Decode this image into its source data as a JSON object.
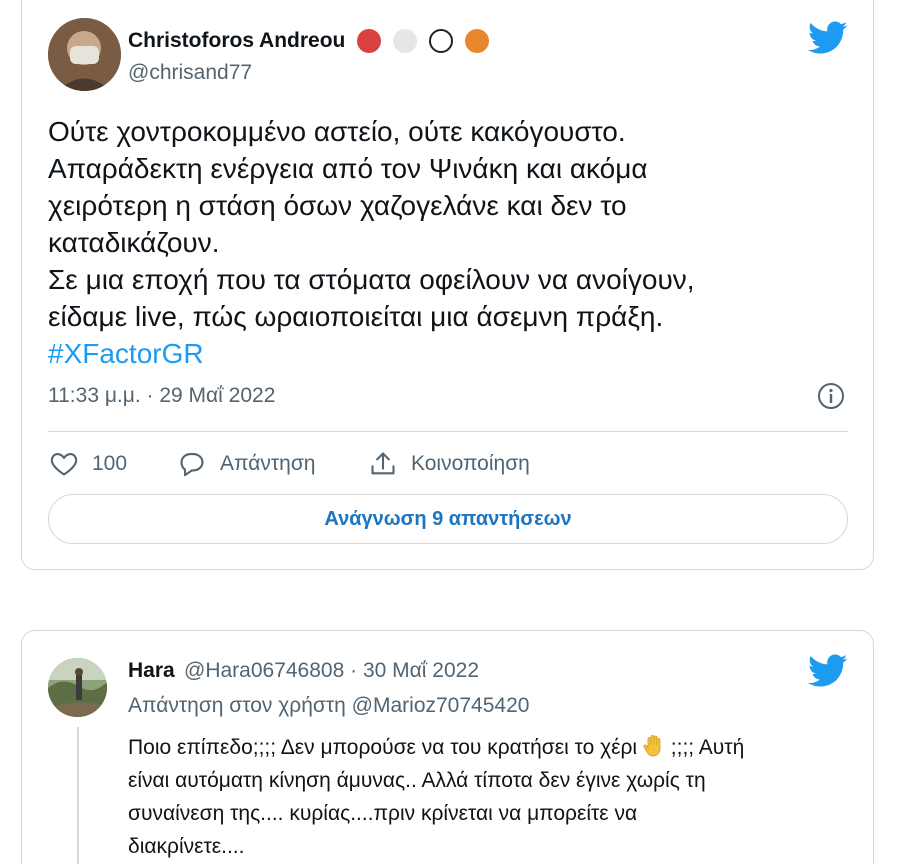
{
  "tweet": {
    "author_name": "Christoforos Andreou",
    "author_handle": "@chrisand77",
    "text_lines": [
      "Ούτε χοντροκομμένο αστείο, ούτε κακόγουστο.",
      "Απαράδεκτη ενέργεια από τον Ψινάκη και ακόμα",
      "χειρότερη η στάση όσων χαζογελάνε και δεν το",
      "καταδικάζουν.",
      "Σε μια εποχή που τα στόματα οφείλουν να ανοίγουν,",
      "είδαμε live, πώς ωραιοποιείται μια άσεμνη πράξη."
    ],
    "hashtag": "#XFactorGR",
    "timestamp": "11:33 μ.μ. · 29 Μαΐ 2022",
    "like_count": "100",
    "reply_label": "Απάντηση",
    "share_label": "Κοινοποίηση",
    "read_replies_label": "Ανάγνωση 9 απαντήσεων"
  },
  "reply": {
    "author_name": "Hara",
    "author_handle": "@Hara06746808",
    "separator": "·",
    "date": "30 Μαΐ 2022",
    "replying_to": "Απάντηση στον χρήστη @Marioz70745420",
    "text_line_1a": "Ποιο επίπεδο;;;; Δεν μπορούσε να του κρατήσει το χέρι ",
    "text_line_1b": ";;;; Αυτή",
    "text_lines": [
      "είναι αυτόματη κίνηση άμυνας..  Αλλά τίποτα δεν έγινε χωρίς τη",
      "συναίνεση της.... κυρίας....πριν κρίνεται να μπορείτε να",
      "διακρίνετε...."
    ]
  },
  "colors": {
    "twitter_blue": "#1d9bf0",
    "text_secondary": "#536471",
    "border": "#cfd9de"
  },
  "icons": [
    "red-circle-icon",
    "white-circle-icon",
    "soccer-ball-icon",
    "basketball-icon",
    "twitter-bird-icon",
    "info-icon",
    "heart-icon",
    "reply-bubble-icon",
    "share-icon",
    "raised-hand-icon"
  ]
}
